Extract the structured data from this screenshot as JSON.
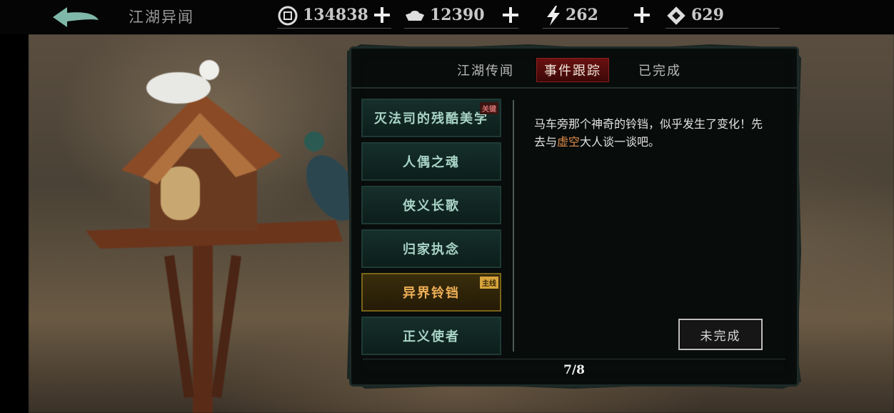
{
  "header": {
    "title": "江湖异闻",
    "resources": [
      {
        "icon": "copper-coin-icon",
        "value": "134838"
      },
      {
        "icon": "silver-ingot-icon",
        "value": "12390"
      },
      {
        "icon": "lightning-icon",
        "value": "262"
      },
      {
        "icon": "ticket-icon",
        "value": "629"
      }
    ]
  },
  "tabs": [
    {
      "label": "江湖传闻",
      "active": false
    },
    {
      "label": "事件跟踪",
      "active": true
    },
    {
      "label": "已完成",
      "active": false
    }
  ],
  "quests": [
    {
      "label": "灭法司的残酷美学",
      "tag": "关键"
    },
    {
      "label": "人偶之魂",
      "tag": ""
    },
    {
      "label": "侠义长歌",
      "tag": ""
    },
    {
      "label": "归家执念",
      "tag": ""
    },
    {
      "label": "异界铃铛",
      "tag": "主线",
      "selected": true
    },
    {
      "label": "正义使者",
      "tag": ""
    }
  ],
  "detail": {
    "text_before": "马车旁那个神奇的铃铛，似乎发生了变化！先去与",
    "highlight": "虚空",
    "text_after": "大人谈一谈吧。",
    "status_label": "未完成"
  },
  "pager": "7/8",
  "colors": {
    "highlight": "#e08a4a",
    "selected_quest": "#f0b058",
    "active_tab": "#6b1010"
  }
}
